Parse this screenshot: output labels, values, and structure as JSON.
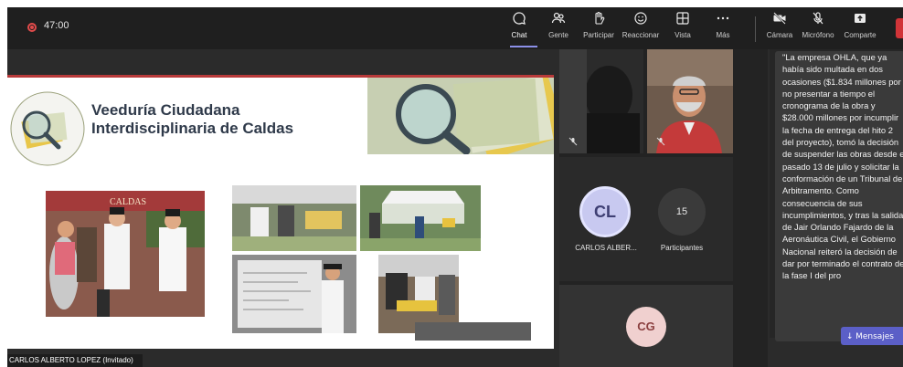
{
  "meeting": {
    "timer": "47:00",
    "toolbar": [
      {
        "label": "Chat",
        "icon": "chat-icon",
        "glyph": "☺",
        "active": true
      },
      {
        "label": "Gente",
        "icon": "people-icon",
        "glyph": "⚇"
      },
      {
        "label": "Participar",
        "icon": "raise-hand-icon",
        "glyph": "✋"
      },
      {
        "label": "Reaccionar",
        "icon": "react-icon",
        "glyph": "☺"
      },
      {
        "label": "Vista",
        "icon": "view-icon",
        "glyph": "⊞"
      },
      {
        "label": "Más",
        "icon": "more-icon",
        "glyph": "…"
      },
      {
        "label": "Cámara",
        "icon": "camera-off-icon",
        "glyph": "■"
      },
      {
        "label": "Micrófono",
        "icon": "mic-off-icon",
        "glyph": "✕"
      },
      {
        "label": "Comparte",
        "icon": "share-icon",
        "glyph": "⇪"
      }
    ]
  },
  "slide": {
    "logo_text": "VEEDURIA CIUDADANA INTERDISCIPLINARIA DE CALDAS",
    "title_line1": "Veeduría Ciudadana",
    "title_line2": "Interdisciplinaria de Caldas",
    "banner_text": "CALDAS"
  },
  "presenter_label": "CARLOS ALBERTO LOPEZ (Invitado)",
  "participants": {
    "cl_initials": "CL",
    "cl_name": "CARLOS ALBER...",
    "count": "15",
    "count_label": "Participantes",
    "cg_initials": "CG"
  },
  "chat": {
    "message": "\"La empresa OHLA, que ya había sido multada en dos ocasiones ($1.834 millones por no presentar a tiempo el cronograma de la obra y $28.000 millones por incumplir la fecha de entrega del hito 2 del proyecto), tomó la decisión de suspender las obras desde el pasado 13 de julio y solicitar la conformación de un Tribunal de Arbitramento. Como consecuencia de sus incumplimientos, y tras la salida de Jair Orlando Fajardo de la Aeronáutica Civil, el Gobierno Nacional reiteró la decisión de dar por terminado el contrato de la fase I del pro",
    "new_messages_label": "Mensajes"
  },
  "colors": {
    "toolbar_bg": "#1f1f1f",
    "stage_bg": "#2b2b2b",
    "accent": "#5b5fc7",
    "record": "#e24b4b",
    "leave": "#d13438",
    "avatar_bg": "#c8c9f0"
  }
}
